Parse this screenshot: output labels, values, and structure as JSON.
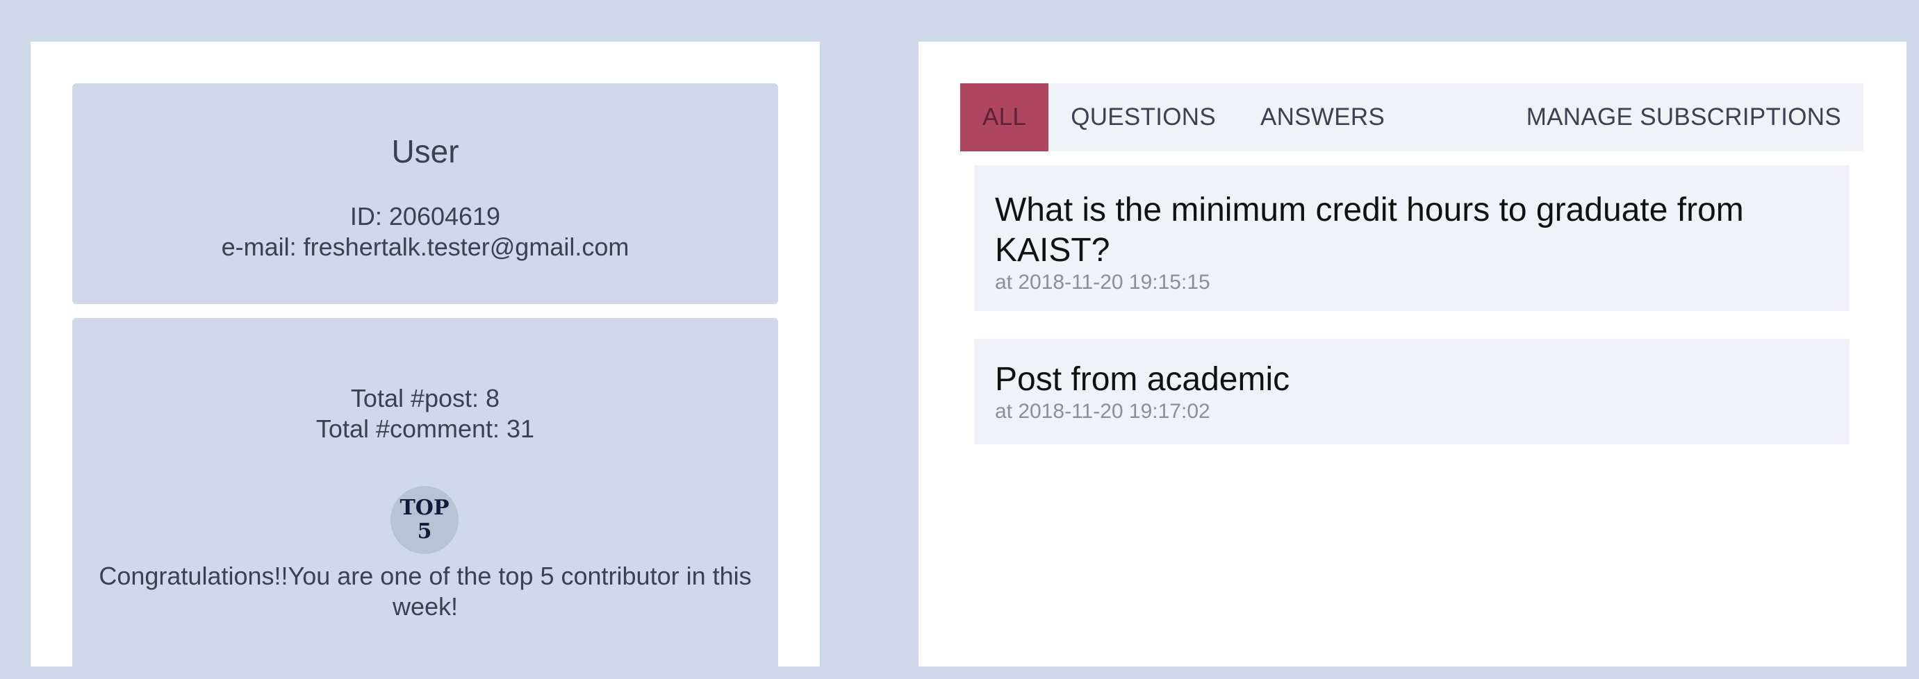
{
  "profile": {
    "name": "User",
    "id_text": "ID: 20604619",
    "email_text": "e-mail: freshertalk.tester@gmail.com"
  },
  "stats": {
    "posts_text": "Total #post: 8",
    "comments_text": "Total #comment: 31",
    "badge_line1": "TOP",
    "badge_line2": "5",
    "congrats_text": "Congratulations!!You are one of the top 5 contributor in this week!"
  },
  "tabs": {
    "all": "ALL",
    "questions": "QUESTIONS",
    "answers": "ANSWERS",
    "manage": "MANAGE SUBSCRIPTIONS",
    "active": "ALL"
  },
  "posts": [
    {
      "title": "What is the minimum credit hours to graduate from KAIST?",
      "time": "at 2018-11-20 19:15:15"
    },
    {
      "title": "Post from academic",
      "time": "at 2018-11-20 19:17:02"
    }
  ],
  "colors": {
    "background": "#d0d9ea",
    "active_tab": "#b0455f",
    "card": "#eff2f6"
  }
}
